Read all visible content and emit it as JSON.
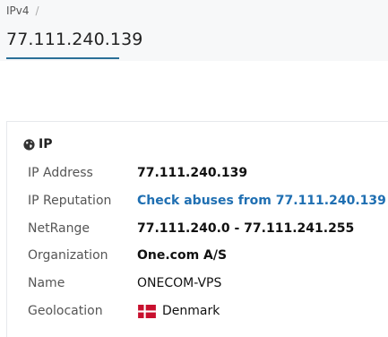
{
  "breadcrumb": {
    "item": "IPv4",
    "separator": "/"
  },
  "page_title": "77.111.240.139",
  "section": {
    "icon": "globe-icon",
    "title": "IP"
  },
  "rows": [
    {
      "label": "IP Address",
      "value": "77.111.240.139"
    },
    {
      "label": "IP Reputation",
      "value": "Check abuses from 77.111.240.139",
      "icon": "external-link-icon"
    },
    {
      "label": "NetRange",
      "value": "77.111.240.0 - 77.111.241.255"
    },
    {
      "label": "Organization",
      "value": "One.com A/S"
    },
    {
      "label": "Name",
      "value": "ONECOM-VPS"
    },
    {
      "label": "Geolocation",
      "value": "Denmark",
      "icon": "denmark-flag-icon"
    }
  ],
  "colors": {
    "link": "#1f6fb2",
    "accent": "#2a6f97",
    "flag_red": "#c8102e"
  }
}
